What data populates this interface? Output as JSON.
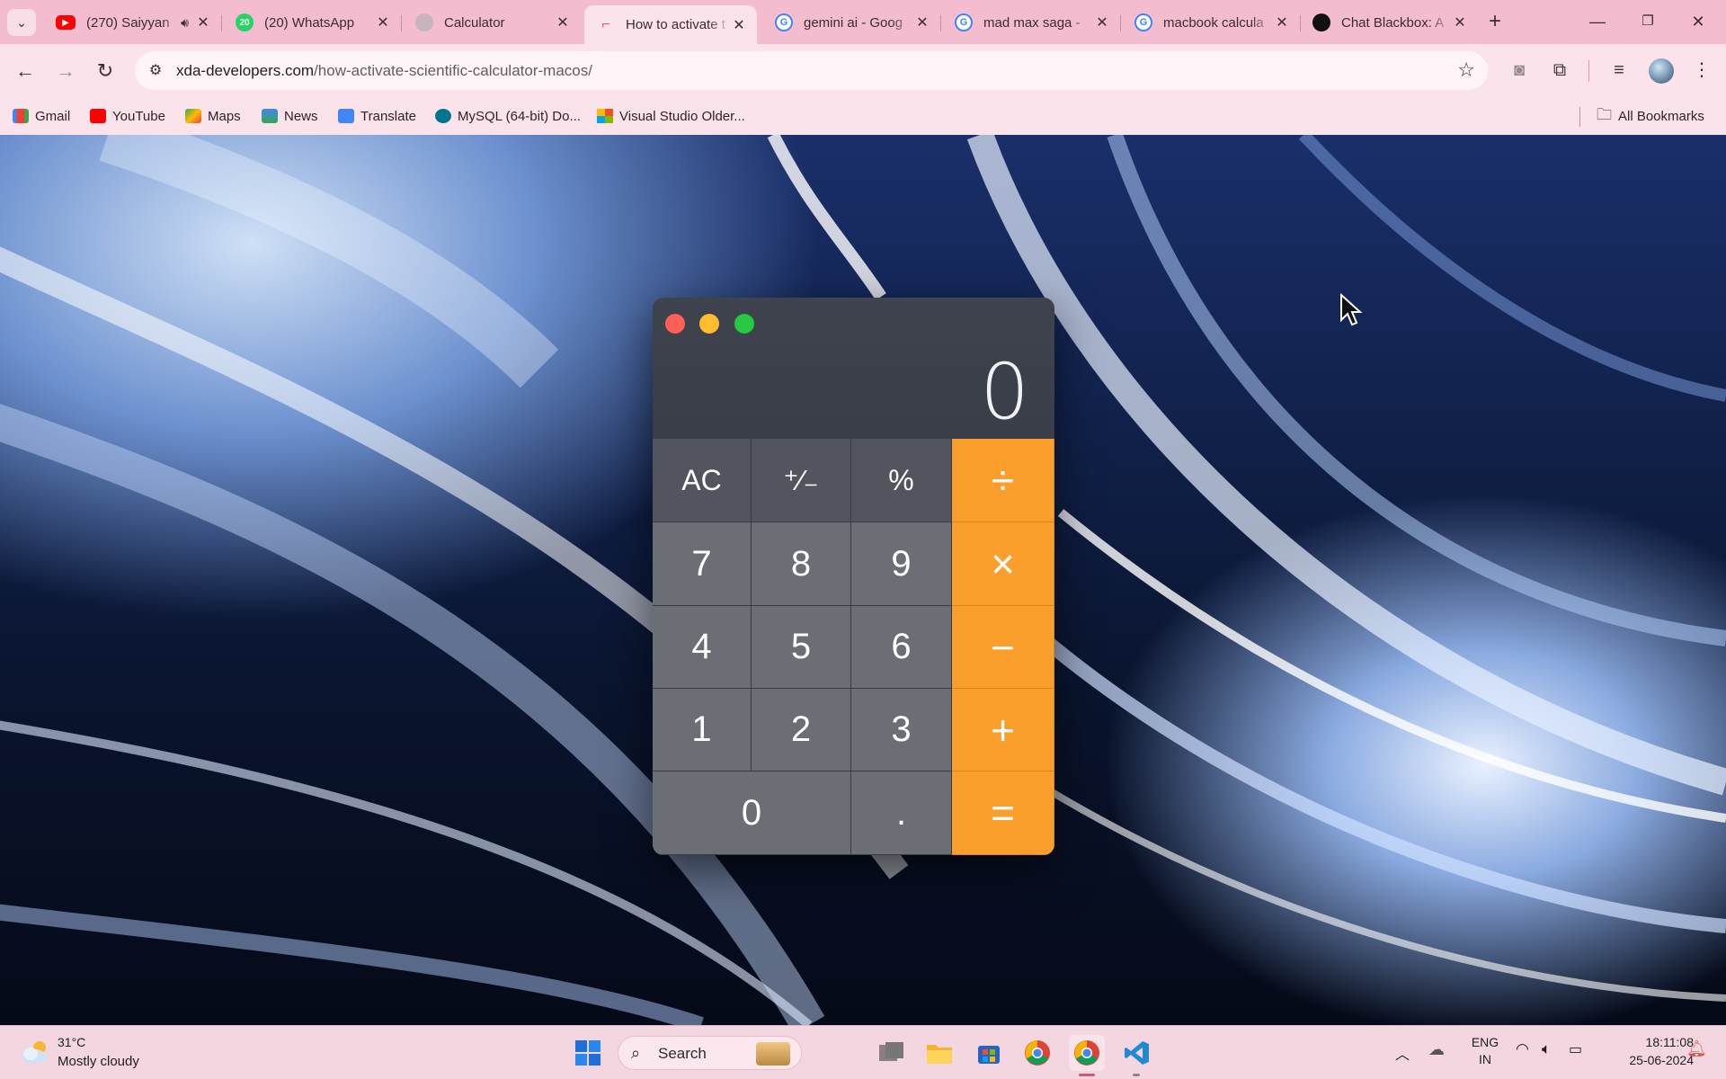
{
  "browser": {
    "tabs": [
      {
        "title": "(270) Saiyyan",
        "favicon": "youtube-icon",
        "color": "#ff0000",
        "audio": true
      },
      {
        "title": "(20) WhatsApp",
        "favicon": "whatsapp-icon",
        "color": "#25d366",
        "badge": "20"
      },
      {
        "title": "Calculator",
        "favicon": "globe-icon",
        "color": "#b9a4ae"
      },
      {
        "title": "How to activate t",
        "favicon": "xda-icon",
        "color": "#e0587a",
        "active": true
      },
      {
        "title": "gemini ai - Goog",
        "favicon": "google-icon",
        "color": "#4285f4"
      },
      {
        "title": "mad max saga -",
        "favicon": "google-icon",
        "color": "#4285f4"
      },
      {
        "title": "macbook calcula",
        "favicon": "google-icon",
        "color": "#4285f4"
      },
      {
        "title": "Chat Blackbox: A",
        "favicon": "blackbox-icon",
        "color": "#111111"
      }
    ],
    "url_domain": "xda-developers.com",
    "url_path": "/how-activate-scientific-calculator-macos/",
    "bookmarks": [
      {
        "label": "Gmail",
        "icon": "gmail-icon",
        "color": "#ea4335"
      },
      {
        "label": "YouTube",
        "icon": "youtube-icon",
        "color": "#ff0000"
      },
      {
        "label": "Maps",
        "icon": "maps-icon",
        "color": "#34a853"
      },
      {
        "label": "News",
        "icon": "news-icon",
        "color": "#4285f4"
      },
      {
        "label": "Translate",
        "icon": "translate-icon",
        "color": "#4285f4"
      },
      {
        "label": "MySQL (64-bit) Do...",
        "icon": "mysql-icon",
        "color": "#00758f"
      },
      {
        "label": "Visual Studio Older...",
        "icon": "microsoft-icon",
        "color": "#f25022"
      }
    ],
    "all_bookmarks": "All Bookmarks"
  },
  "calculator": {
    "display": "0",
    "keys": {
      "ac": "AC",
      "plusminus": "⁺∕₋",
      "percent": "%",
      "divide": "÷",
      "k7": "7",
      "k8": "8",
      "k9": "9",
      "multiply": "×",
      "k4": "4",
      "k5": "5",
      "k6": "6",
      "minus": "−",
      "k1": "1",
      "k2": "2",
      "k3": "3",
      "plus": "+",
      "k0": "0",
      "decimal": ".",
      "equals": "="
    },
    "accent_color": "#fb9f2c"
  },
  "taskbar": {
    "weather_temp": "31°C",
    "weather_desc": "Mostly cloudy",
    "search_label": "Search",
    "lang_line1": "ENG",
    "lang_line2": "IN",
    "time": "18:11:08",
    "date": "25-06-2024"
  }
}
